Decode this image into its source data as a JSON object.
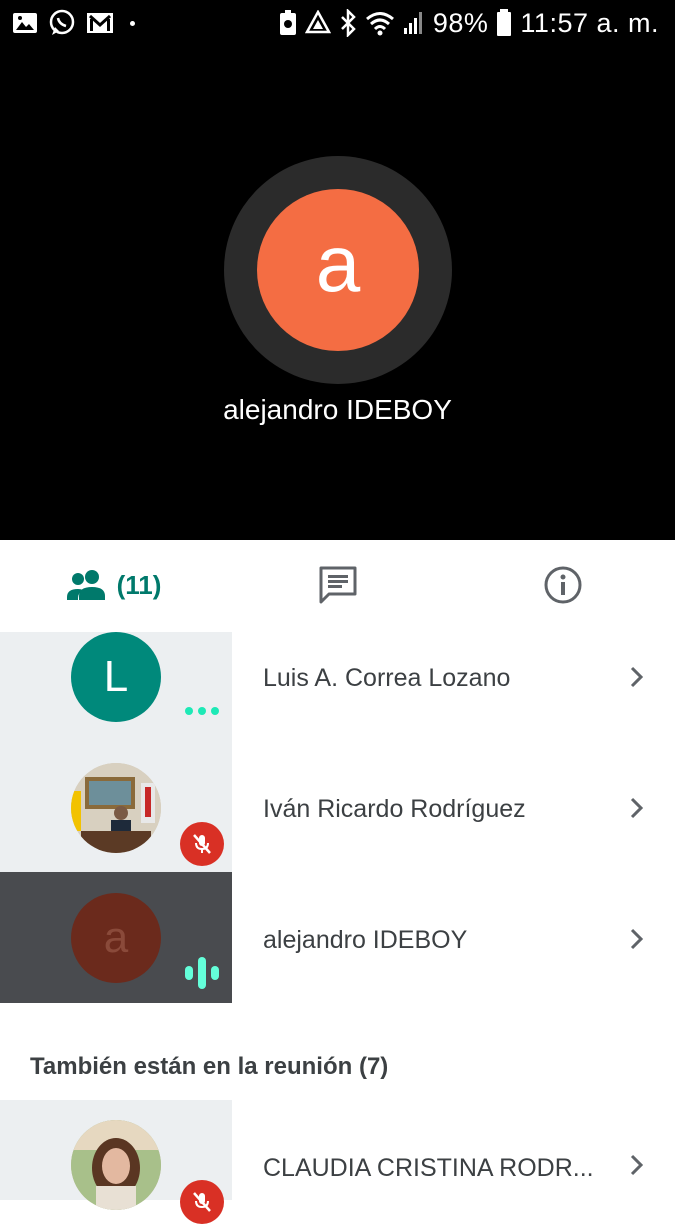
{
  "status_bar": {
    "battery": "98%",
    "time": "11:57 a. m."
  },
  "stage": {
    "avatar_letter": "a",
    "speaker_name": "alejandro IDEBOY",
    "avatar_color": "#f46d43"
  },
  "tabs": {
    "people_count": "(11)",
    "people_icon": "people-icon",
    "chat_icon": "chat-icon",
    "info_icon": "info-icon",
    "accent_color": "#00796b"
  },
  "participants": [
    {
      "letter": "L",
      "name": "Luis A. Correa Lozano",
      "status": "more-dots",
      "avatar_color": "#00897b"
    },
    {
      "letter": "",
      "name": "Iván Ricardo Rodríguez",
      "status": "muted",
      "avatar_color": "#8d6e63"
    },
    {
      "letter": "a",
      "name": "alejandro IDEBOY",
      "status": "speaking",
      "avatar_color": "#6b2a1c"
    }
  ],
  "section": {
    "title": "También están en la reunión (7)"
  },
  "others": [
    {
      "name": "CLAUDIA CRISTINA RODR...",
      "status": "muted"
    }
  ]
}
